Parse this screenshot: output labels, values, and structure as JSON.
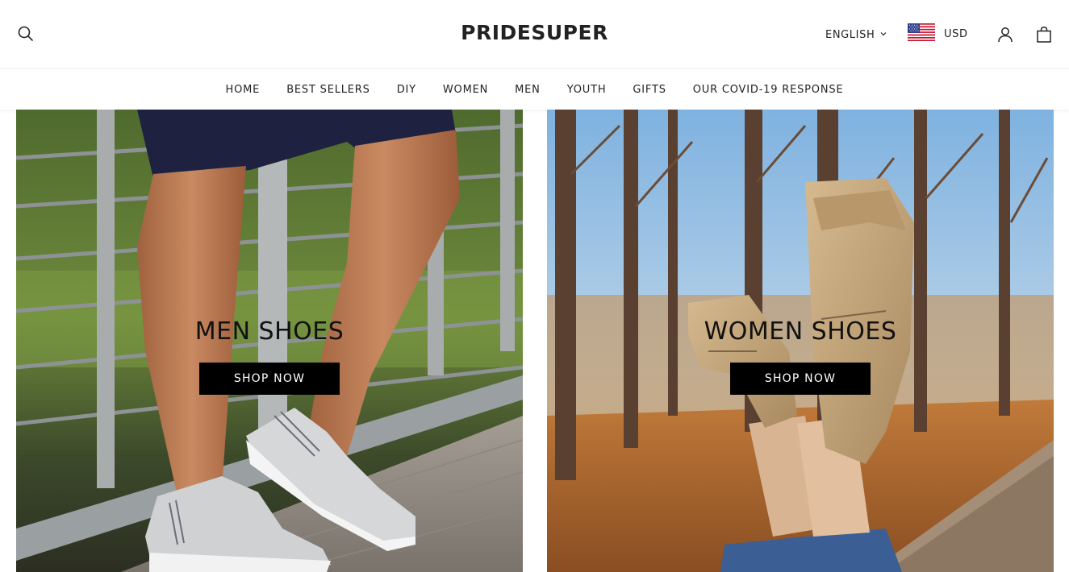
{
  "header": {
    "logo": "PRIDESUPER",
    "language": "ENGLISH",
    "currency": "USD",
    "icons": {
      "search": "search-icon",
      "language_caret": "chevron-down-icon",
      "flag": "us-flag-icon",
      "account": "user-icon",
      "cart": "shopping-bag-icon"
    }
  },
  "nav": {
    "items": [
      {
        "label": "HOME"
      },
      {
        "label": "BEST SELLERS"
      },
      {
        "label": "DIY"
      },
      {
        "label": "WOMEN"
      },
      {
        "label": "MEN"
      },
      {
        "label": "YOUTH"
      },
      {
        "label": "GIFTS"
      },
      {
        "label": "OUR COVID-19 RESPONSE"
      }
    ]
  },
  "banners": [
    {
      "title": "MEN SHOES",
      "button": "SHOP NOW"
    },
    {
      "title": "WOMEN SHOES",
      "button": "SHOP NOW"
    }
  ],
  "colors": {
    "text": "#222222",
    "button_bg": "#000000",
    "button_text": "#ffffff"
  }
}
